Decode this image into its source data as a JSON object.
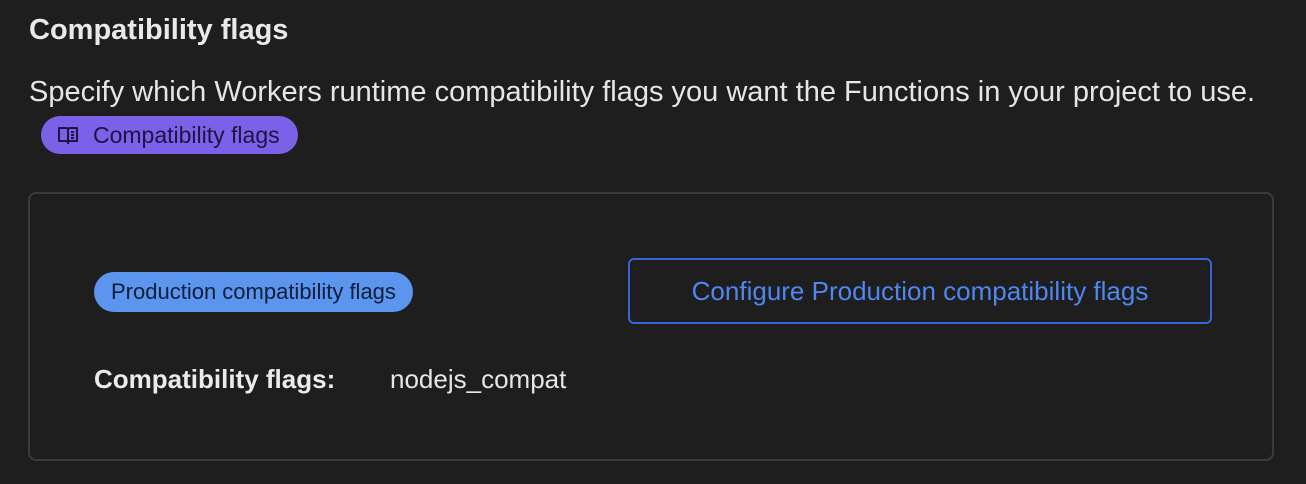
{
  "section": {
    "title": "Compatibility flags",
    "description": "Specify which Workers runtime compatibility flags you want the Functions in your project to use.",
    "doc_link_label": "Compatibility flags",
    "doc_link_icon": "book-icon"
  },
  "card": {
    "environment_badge": "Production compatibility flags",
    "configure_button_label": "Configure Production compatibility flags",
    "flags_label": "Compatibility flags:",
    "flags_value": "nodejs_compat"
  },
  "colors": {
    "background": "#1e1e1f",
    "doc_link_bg": "#7b61e8",
    "badge_bg": "#5b95ee",
    "button_border": "#3466d8",
    "button_text": "#4f86f0"
  }
}
